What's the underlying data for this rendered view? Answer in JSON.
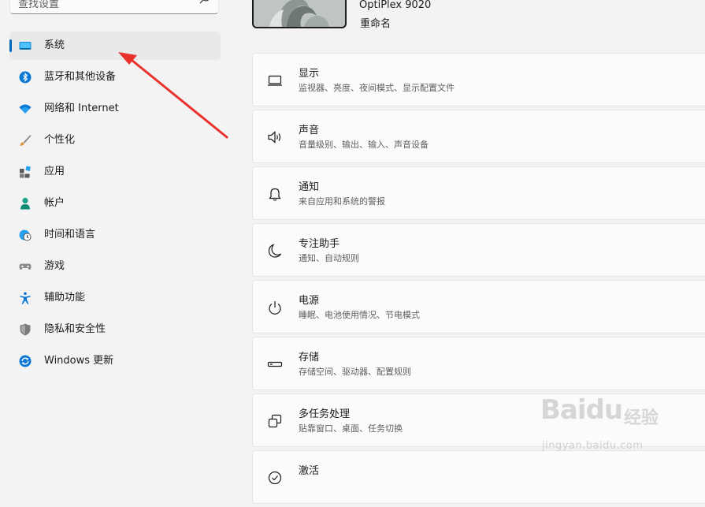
{
  "search": {
    "placeholder": "查找设置",
    "icon": "search-icon"
  },
  "device": {
    "name": "OptiPlex 9020",
    "rename": "重命名"
  },
  "nav": {
    "items": [
      {
        "label": "系统",
        "icon": "system-icon",
        "active": true
      },
      {
        "label": "蓝牙和其他设备",
        "icon": "bluetooth-icon"
      },
      {
        "label": "网络和 Internet",
        "icon": "wifi-icon"
      },
      {
        "label": "个性化",
        "icon": "brush-icon"
      },
      {
        "label": "应用",
        "icon": "apps-icon"
      },
      {
        "label": "帐户",
        "icon": "account-icon"
      },
      {
        "label": "时间和语言",
        "icon": "clock-globe-icon"
      },
      {
        "label": "游戏",
        "icon": "gamepad-icon"
      },
      {
        "label": "辅助功能",
        "icon": "accessibility-icon"
      },
      {
        "label": "隐私和安全性",
        "icon": "shield-icon"
      },
      {
        "label": "Windows 更新",
        "icon": "update-icon"
      }
    ]
  },
  "cards": [
    {
      "title": "显示",
      "subtitle": "监视器、亮度、夜间模式、显示配置文件",
      "icon": "display-icon"
    },
    {
      "title": "声音",
      "subtitle": "音量级别、输出、输入、声音设备",
      "icon": "speaker-icon"
    },
    {
      "title": "通知",
      "subtitle": "来自应用和系统的警报",
      "icon": "bell-icon"
    },
    {
      "title": "专注助手",
      "subtitle": "通知、自动规则",
      "icon": "moon-icon"
    },
    {
      "title": "电源",
      "subtitle": "睡眠、电池使用情况、节电模式",
      "icon": "power-icon"
    },
    {
      "title": "存储",
      "subtitle": "存储空间、驱动器、配置规则",
      "icon": "storage-icon"
    },
    {
      "title": "多任务处理",
      "subtitle": "贴靠窗口、桌面、任务切换",
      "icon": "multitask-icon"
    },
    {
      "title": "激活",
      "subtitle": "",
      "icon": "activation-icon"
    }
  ],
  "watermark": {
    "brand": "Baidu",
    "brand_cn": "经验",
    "url": "jingyan.baidu.com"
  },
  "colors": {
    "accent": "#0067c0",
    "annotation": "#e8322b"
  }
}
